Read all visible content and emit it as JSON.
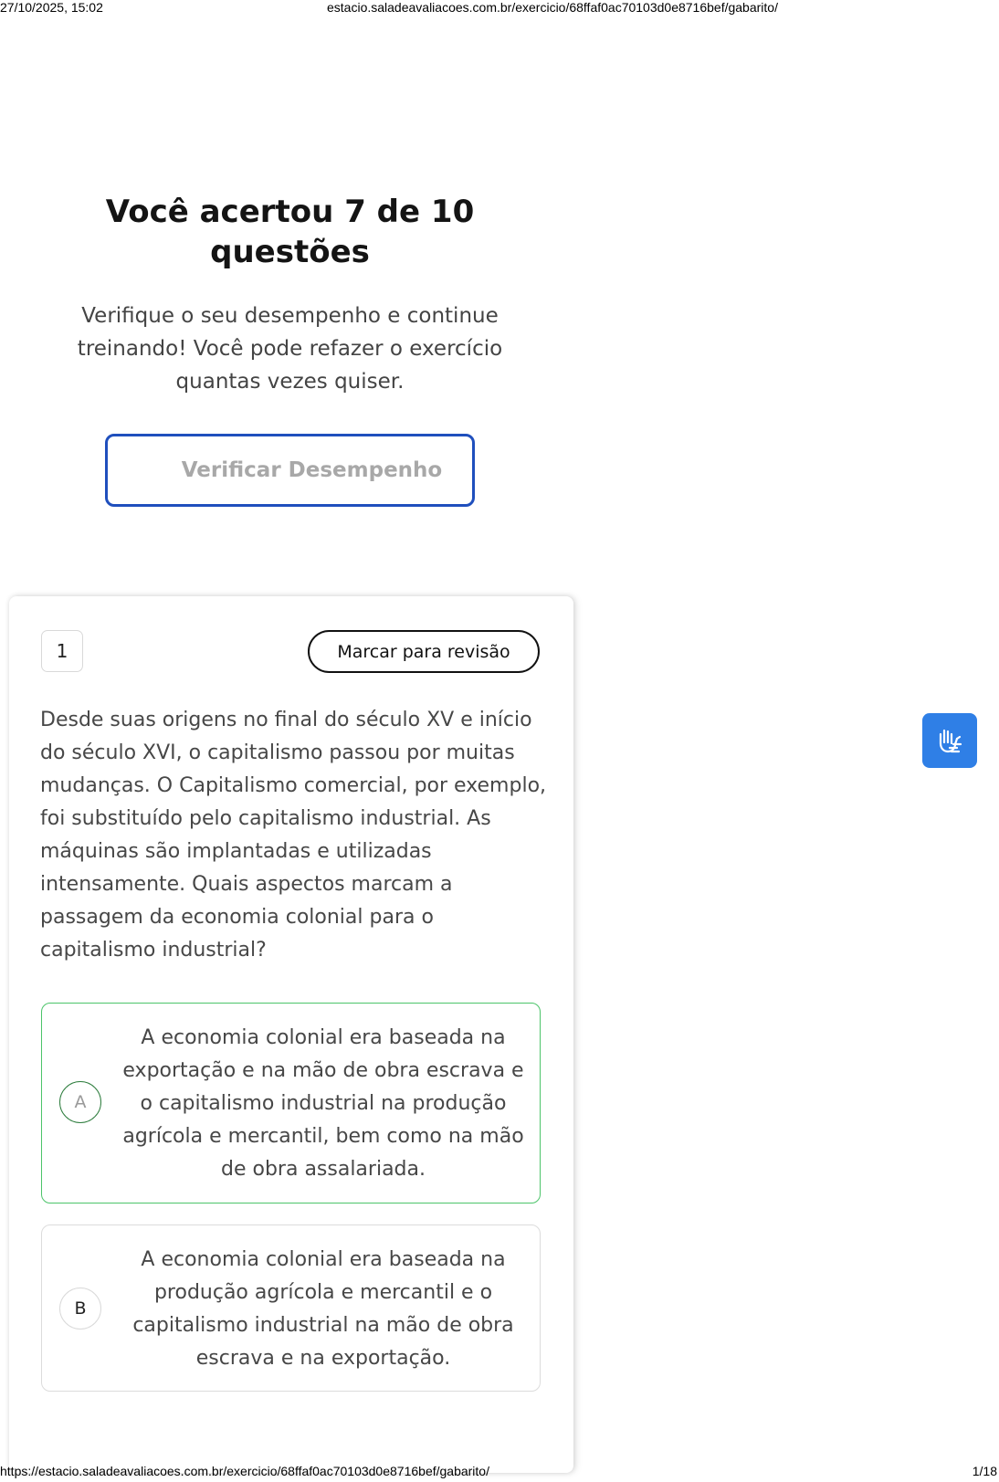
{
  "print_header": {
    "datetime": "27/10/2025, 15:02",
    "url": "estacio.saladeavaliacoes.com.br/exercicio/68ffaf0ac70103d0e8716bef/gabarito/"
  },
  "print_footer": {
    "url": "https://estacio.saladeavaliacoes.com.br/exercicio/68ffaf0ac70103d0e8716bef/gabarito/",
    "page": "1/18"
  },
  "result": {
    "title": "Você acertou 7 de 10 questões",
    "description": "Verifique o seu desempenho e continue treinando! Você pode refazer o exercício quantas vezes quiser.",
    "verify_label": "Verificar Desempenho"
  },
  "question": {
    "number": "1",
    "review_label": "Marcar para revisão",
    "text": "Desde suas origens no final do século XV e início do século XVI, o capitalismo passou por muitas mudanças. O Capitalismo comercial, por exemplo, foi substituído pelo capitalismo industrial. As máquinas são implantadas e utilizadas intensamente. Quais aspectos marcam a passagem da economia colonial para o capitalismo industrial?",
    "options": [
      {
        "letter": "A",
        "text": "A economia colonial era baseada na exportação e na mão de obra escrava e o capitalismo industrial na produção agrícola e mercantil, bem como na mão de obra assalariada."
      },
      {
        "letter": "B",
        "text": "A economia colonial era baseada na produção agrícola e mercantil e o capitalismo industrial na mão de obra escrava e na exportação."
      }
    ]
  },
  "icons": {
    "accessibility": "sign-language-icon"
  },
  "colors": {
    "verify_border": "#1f4fbd",
    "correct_border": "#4cc46a",
    "accessibility_bg": "#2f7fe6"
  }
}
